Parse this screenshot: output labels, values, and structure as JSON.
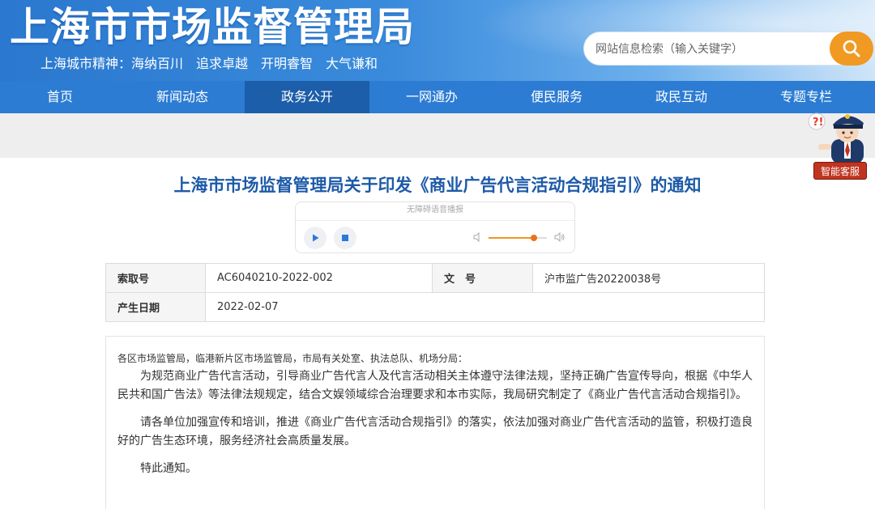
{
  "header": {
    "title": "上海市市场监督管理局",
    "slogan": "上海城市精神：海纳百川　追求卓越　开明睿智　大气谦和",
    "search_placeholder": "网站信息检索（输入关键字）",
    "search_icon": "search-icon",
    "accent_color": "#f09a23"
  },
  "nav": {
    "items": [
      {
        "label": "首页"
      },
      {
        "label": "新闻动态"
      },
      {
        "label": "政务公开"
      },
      {
        "label": "一网通办"
      },
      {
        "label": "便民服务"
      },
      {
        "label": "政民互动"
      },
      {
        "label": "专题专栏"
      }
    ],
    "active_index": 2,
    "bg_color": "#2c7cd4",
    "active_color": "#1c5ea9"
  },
  "assistant": {
    "label": "智能客服",
    "icon": "customer-service-avatar-icon"
  },
  "article": {
    "title": "上海市市场监督管理局关于印发《商业广告代言活动合规指引》的通知",
    "title_color": "#1d5aa8"
  },
  "player": {
    "caption": "无障碍语音播报",
    "play_icon": "play-icon",
    "stop_icon": "stop-icon",
    "volume_level": 0.78
  },
  "meta": {
    "index_label": "索取号",
    "index_value": "AC6040210-2022-002",
    "doc_label": "文　号",
    "doc_value": "沪市监广告20220038号",
    "date_label": "产生日期",
    "date_value": "2022-02-07"
  },
  "body": {
    "addressee": "各区市场监管局，临港新片区市场监管局，市局有关处室、执法总队、机场分局：",
    "paragraphs": [
      "为规范商业广告代言活动，引导商业广告代言人及代言活动相关主体遵守法律法规，坚持正确广告宣传导向，根据《中华人民共和国广告法》等法律法规规定，结合文娱领域综合治理要求和本市实际，我局研究制定了《商业广告代言活动合规指引》。",
      "请各单位加强宣传和培训，推进《商业广告代言活动合规指引》的落实，依法加强对商业广告代言活动的监管，积极打造良好的广告生态环境，服务经济社会高质量发展。",
      "特此通知。"
    ]
  }
}
